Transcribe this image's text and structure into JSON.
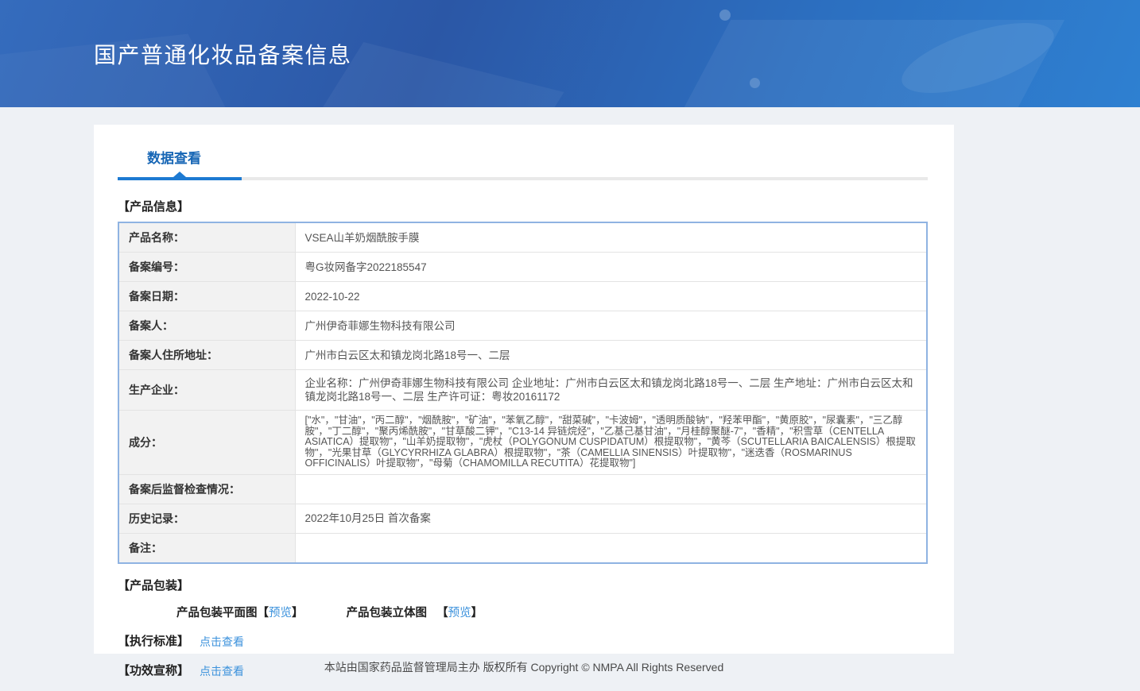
{
  "colors": {
    "banner_gradient_start": "#2b57a6",
    "banner_gradient_end": "#2e80d1",
    "tab_accent": "#1d7ad2",
    "tab_text": "#1766b5",
    "link": "#3c92dc",
    "table_border": "#8fb3e2",
    "label_bg": "#f2f2f2",
    "page_bg": "#eef1f5"
  },
  "banner": {
    "title": "国产普通化妆品备案信息"
  },
  "tabs": {
    "data_view": "数据查看"
  },
  "product_info": {
    "heading": "【产品信息】",
    "rows": [
      {
        "label": "产品名称：",
        "value": "VSEA山羊奶烟酰胺手膜"
      },
      {
        "label": "备案编号：",
        "value": "粤G妆网备字2022185547"
      },
      {
        "label": "备案日期：",
        "value": "2022-10-22"
      },
      {
        "label": "备案人：",
        "value": "广州伊奇菲娜生物科技有限公司"
      },
      {
        "label": "备案人住所地址：",
        "value": "广州市白云区太和镇龙岗北路18号一、二层"
      },
      {
        "label": "生产企业：",
        "value": "企业名称：广州伊奇菲娜生物科技有限公司 企业地址：广州市白云区太和镇龙岗北路18号一、二层 生产地址：广州市白云区太和镇龙岗北路18号一、二层 生产许可证：粤妆20161172"
      },
      {
        "label": "成分：",
        "value": "[\"水\"，\"甘油\"，\"丙二醇\"，\"烟酰胺\"，\"矿油\"，\"苯氧乙醇\"，\"甜菜碱\"，\"卡波姆\"，\"透明质酸钠\"，\"羟苯甲酯\"，\"黄原胶\"，\"尿囊素\"，\"三乙醇胺\"，\"丁二醇\"，\"聚丙烯酰胺\"，\"甘草酸二钾\"，\"C13-14 异链烷烃\"，\"乙基己基甘油\"，\"月桂醇聚醚-7\"，\"香精\"，\"积雪草（CENTELLA ASIATICA）提取物\"，\"山羊奶提取物\"，\"虎杖（POLYGONUM CUSPIDATUM）根提取物\"，\"黄芩（SCUTELLARIA BAICALENSIS）根提取物\"，\"光果甘草（GLYCYRRHIZA GLABRA）根提取物\"，\"茶（CAMELLIA SINENSIS）叶提取物\"，\"迷迭香（ROSMARINUS OFFICINALIS）叶提取物\"，\"母菊（CHAMOMILLA RECUTITA）花提取物\"]"
      },
      {
        "label": "备案后监督检查情况：",
        "value": ""
      },
      {
        "label": "历史记录：",
        "value": "2022年10月25日 首次备案"
      },
      {
        "label": "备注：",
        "value": ""
      }
    ]
  },
  "packaging": {
    "heading": "【产品包装】",
    "flat_label": "产品包装平面图",
    "stereo_label": "产品包装立体图",
    "bracket_open": "【",
    "bracket_close": "】",
    "preview_flat": "预览",
    "preview_stereo": "预览"
  },
  "standards": {
    "heading": "【执行标准】",
    "link": "点击查看"
  },
  "efficacy": {
    "heading": "【功效宣称】",
    "link": "点击查看"
  },
  "footer": {
    "text": "本站由国家药品监督管理局主办 版权所有 Copyright © NMPA All Rights Reserved"
  }
}
